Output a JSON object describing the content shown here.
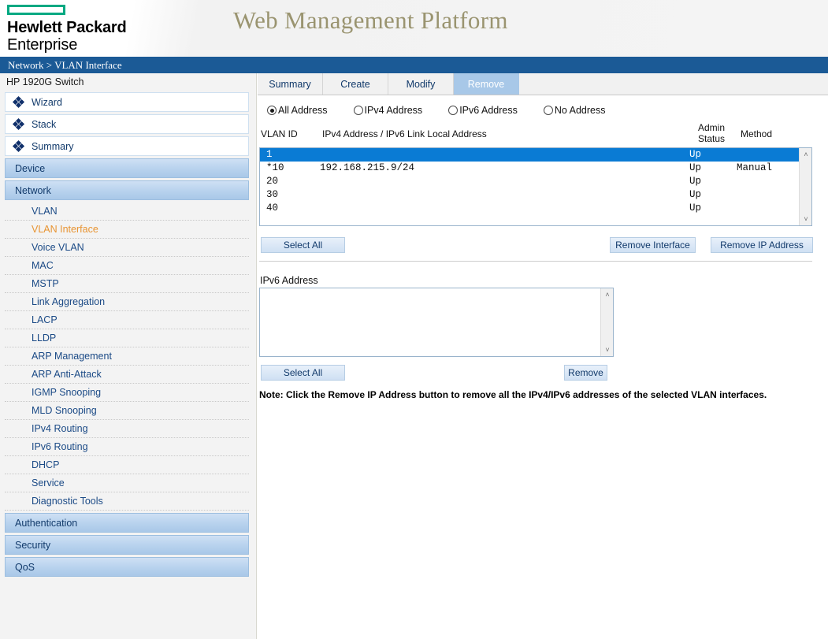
{
  "header": {
    "logo_rect_color": "#01a982",
    "brand_line1": "Hewlett Packard",
    "brand_line2": "Enterprise",
    "platform_title": "Web Management Platform",
    "platform_title_color": "#9a9470"
  },
  "breadcrumb": {
    "text": "Network > VLAN Interface",
    "bar_color": "#1b5a96"
  },
  "sidebar": {
    "device_name": "HP 1920G Switch",
    "top_items": [
      {
        "label": "Wizard"
      },
      {
        "label": "Stack"
      },
      {
        "label": "Summary"
      }
    ],
    "groups": [
      {
        "label": "Device"
      },
      {
        "label": "Network"
      }
    ],
    "network_items": [
      {
        "label": "VLAN",
        "active": false
      },
      {
        "label": "VLAN Interface",
        "active": true
      },
      {
        "label": "Voice VLAN",
        "active": false
      },
      {
        "label": "MAC",
        "active": false
      },
      {
        "label": "MSTP",
        "active": false
      },
      {
        "label": "Link Aggregation",
        "active": false
      },
      {
        "label": "LACP",
        "active": false
      },
      {
        "label": "LLDP",
        "active": false
      },
      {
        "label": "ARP Management",
        "active": false
      },
      {
        "label": "ARP Anti-Attack",
        "active": false
      },
      {
        "label": "IGMP Snooping",
        "active": false
      },
      {
        "label": "MLD Snooping",
        "active": false
      },
      {
        "label": "IPv4 Routing",
        "active": false
      },
      {
        "label": "IPv6 Routing",
        "active": false
      },
      {
        "label": "DHCP",
        "active": false
      },
      {
        "label": "Service",
        "active": false
      },
      {
        "label": "Diagnostic Tools",
        "active": false
      }
    ],
    "bottom_groups": [
      {
        "label": "Authentication"
      },
      {
        "label": "Security"
      },
      {
        "label": "QoS"
      }
    ],
    "active_item_color": "#e89432"
  },
  "main": {
    "tabs": [
      {
        "label": "Summary",
        "active": false
      },
      {
        "label": "Create",
        "active": false
      },
      {
        "label": "Modify",
        "active": false
      },
      {
        "label": "Remove",
        "active": true
      }
    ],
    "filters": [
      {
        "label": "All Address",
        "checked": true
      },
      {
        "label": "IPv4 Address",
        "checked": false
      },
      {
        "label": "IPv6 Address",
        "checked": false
      },
      {
        "label": "No Address",
        "checked": false
      }
    ],
    "table": {
      "columns": {
        "vlan_id": "VLAN ID",
        "address": "IPv4 Address / IPv6 Link Local Address",
        "admin_status_line1": "Admin",
        "admin_status_line2": "Status",
        "method": "Method"
      },
      "rows": [
        {
          "vlan_id": "1",
          "address": "",
          "admin_status": "Up",
          "method": "",
          "selected": true
        },
        {
          "vlan_id": "*10",
          "address": "192.168.215.9/24",
          "admin_status": "Up",
          "method": "Manual",
          "selected": false
        },
        {
          "vlan_id": " 20",
          "address": "",
          "admin_status": "Up",
          "method": "",
          "selected": false
        },
        {
          "vlan_id": " 30",
          "address": "",
          "admin_status": "Up",
          "method": "",
          "selected": false
        },
        {
          "vlan_id": " 40",
          "address": "",
          "admin_status": "Up",
          "method": "",
          "selected": false
        }
      ],
      "selected_row_color": "#0a7bd4"
    },
    "buttons": {
      "select_all_1": "Select All",
      "remove_interface": "Remove Interface",
      "remove_ip_address": "Remove IP Address",
      "select_all_2": "Select All",
      "remove": "Remove"
    },
    "ipv6_section": {
      "label": "IPv6 Address",
      "entries": []
    },
    "note": "Note: Click the Remove IP Address button to remove all the IPv4/IPv6 addresses of the selected VLAN interfaces."
  },
  "icons": {
    "scroll_up": "˄",
    "scroll_down": "˅"
  }
}
